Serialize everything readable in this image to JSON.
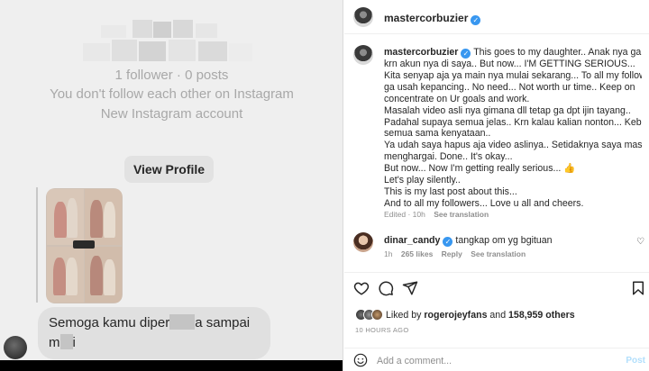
{
  "left_screenshot": {
    "stats": "1 follower · 0 posts",
    "follow_status": "You don't follow each other on Instagram",
    "account_note": "New Instagram account",
    "view_profile_label": "View Profile",
    "message_line1_a": "Semoga kamu diper",
    "message_line1_b": "a sampai",
    "message_line2_a": "m",
    "message_line2_b": "i"
  },
  "post": {
    "author": "mastercorbuzier",
    "caption_lines": [
      "This goes to my daughter.. Anak nya ga baca",
      "krn akun nya di saya.. But now... I'M GETTING SERIOUS...",
      "Kita senyap aja ya main nya mulai sekarang... To all my followers",
      "ga usah kepancing.. No need... Not worth ur time.. Keep on",
      "concentrate on Ur goals and work.",
      "Masalah video asli nya gimana dll tetap ga dpt ijin tayang..",
      "Padahal supaya semua jelas.. Krn kalau kalian nonton... Kebalik",
      "semua sama kenyataan..",
      "Ya udah saya hapus aja video aslinya.. Setidaknya saya masih",
      "menghargai. Done.. It's okay...",
      "But now... Now I'm getting really serious... 👍",
      "Let's play silently..",
      "This is my last post about this...",
      "And to all my followers... Love u all and cheers."
    ],
    "edited": "Edited · 10h",
    "see_translation": "See translation"
  },
  "comment": {
    "author": "dinar_candy",
    "text": "tangkap om yg bgituan",
    "time": "1h",
    "likes": "265 likes",
    "reply": "Reply",
    "see_translation": "See translation"
  },
  "actions": {
    "icons": [
      "heart-icon",
      "comment-icon",
      "share-icon",
      "bookmark-icon"
    ]
  },
  "likes": {
    "prefix": "Liked by ",
    "user": "rogerojeyfans",
    "middle": " and ",
    "others": "158,959 others"
  },
  "timestamp": "10 HOURS AGO",
  "add_comment": {
    "placeholder": "Add a comment...",
    "post_label": "Post"
  },
  "colors": {
    "verified": "#3897f0",
    "muted": "#8e8e8e",
    "post_disabled": "#b2dffc"
  }
}
